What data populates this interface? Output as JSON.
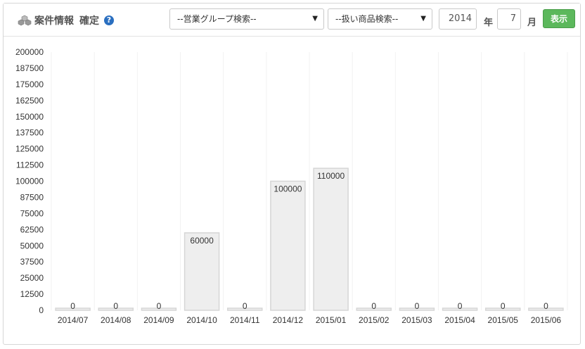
{
  "header": {
    "title": "案件情報",
    "status": "確定",
    "help_glyph": "?",
    "group_select": "--営業グループ検索--",
    "product_select": "--扱い商品検索--",
    "year_value": "2014",
    "year_unit": "年",
    "month_value": "7",
    "month_unit": "月",
    "show_button": "表示"
  },
  "colors": {
    "bar_fill": "#eeeeee",
    "bar_stroke": "#d6d6d6",
    "button": "#5cb85c",
    "help": "#2a6fc0"
  },
  "chart_data": {
    "type": "bar",
    "categories": [
      "2014/07",
      "2014/08",
      "2014/09",
      "2014/10",
      "2014/11",
      "2014/12",
      "2015/01",
      "2015/02",
      "2015/03",
      "2015/04",
      "2015/05",
      "2015/06"
    ],
    "values": [
      0,
      0,
      0,
      60000,
      0,
      100000,
      110000,
      0,
      0,
      0,
      0,
      0
    ],
    "ylim": [
      0,
      200000
    ],
    "yticks": [
      0,
      12500,
      25000,
      37500,
      50000,
      62500,
      75000,
      87500,
      100000,
      112500,
      125000,
      137500,
      150000,
      162500,
      175000,
      187500,
      200000
    ],
    "grid": "vertical",
    "data_labels": true
  }
}
